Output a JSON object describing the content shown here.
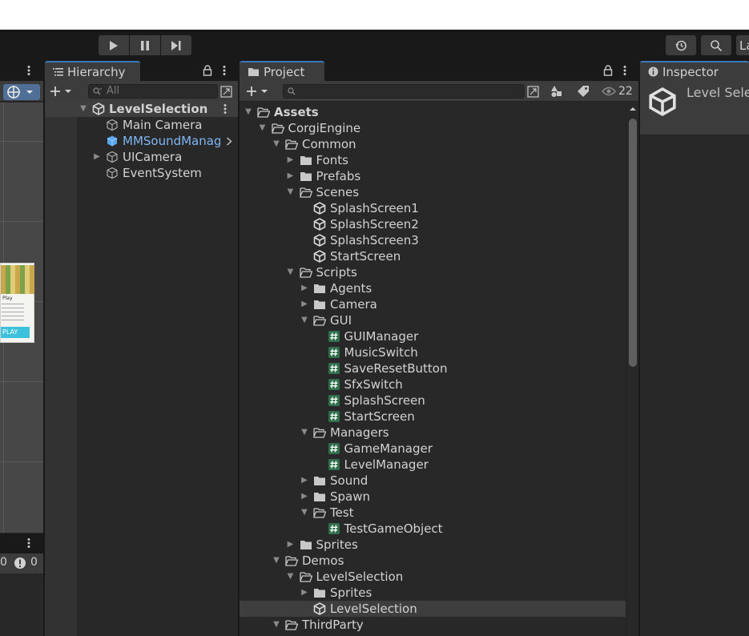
{
  "toolbar": {
    "play_icon": "play-icon",
    "pause_icon": "pause-icon",
    "step_icon": "step-icon",
    "history_icon": "history-icon",
    "search_icon": "search-icon",
    "layers_label": "La"
  },
  "scene": {
    "preview_text_1": "Play",
    "preview_button": "PLAY",
    "console_counts": [
      "0",
      "0"
    ]
  },
  "hierarchy": {
    "tab_label": "Hierarchy",
    "search_placeholder": "All",
    "items": [
      {
        "label": "LevelSelection",
        "icon": "unity-scene-icon"
      },
      {
        "label": "Main Camera",
        "icon": "gameobject-icon"
      },
      {
        "label": "MMSoundManag",
        "icon": "prefab-icon"
      },
      {
        "label": "UICamera",
        "icon": "gameobject-icon"
      },
      {
        "label": "EventSystem",
        "icon": "gameobject-icon"
      }
    ]
  },
  "project": {
    "tab_label": "Project",
    "hidden_count": "22",
    "items": [
      {
        "label": "Assets",
        "type": "folder-open"
      },
      {
        "label": "CorgiEngine",
        "type": "folder-open"
      },
      {
        "label": "Common",
        "type": "folder-open"
      },
      {
        "label": "Fonts",
        "type": "folder"
      },
      {
        "label": "Prefabs",
        "type": "folder"
      },
      {
        "label": "Scenes",
        "type": "folder-open"
      },
      {
        "label": "SplashScreen1",
        "type": "scene"
      },
      {
        "label": "SplashScreen2",
        "type": "scene"
      },
      {
        "label": "SplashScreen3",
        "type": "scene"
      },
      {
        "label": "StartScreen",
        "type": "scene"
      },
      {
        "label": "Scripts",
        "type": "folder-open"
      },
      {
        "label": "Agents",
        "type": "folder"
      },
      {
        "label": "Camera",
        "type": "folder"
      },
      {
        "label": "GUI",
        "type": "folder-open"
      },
      {
        "label": "GUIManager",
        "type": "script"
      },
      {
        "label": "MusicSwitch",
        "type": "script"
      },
      {
        "label": "SaveResetButton",
        "type": "script"
      },
      {
        "label": "SfxSwitch",
        "type": "script"
      },
      {
        "label": "SplashScreen",
        "type": "script"
      },
      {
        "label": "StartScreen",
        "type": "script"
      },
      {
        "label": "Managers",
        "type": "folder-open"
      },
      {
        "label": "GameManager",
        "type": "script"
      },
      {
        "label": "LevelManager",
        "type": "script"
      },
      {
        "label": "Sound",
        "type": "folder"
      },
      {
        "label": "Spawn",
        "type": "folder"
      },
      {
        "label": "Test",
        "type": "folder-open"
      },
      {
        "label": "TestGameObject",
        "type": "script"
      },
      {
        "label": "Sprites",
        "type": "folder"
      },
      {
        "label": "Demos",
        "type": "folder-open"
      },
      {
        "label": "LevelSelection",
        "type": "folder-open"
      },
      {
        "label": "Sprites",
        "type": "folder"
      },
      {
        "label": "LevelSelection",
        "type": "scene"
      },
      {
        "label": "ThirdParty",
        "type": "folder-open"
      }
    ]
  },
  "inspector": {
    "tab_label": "Inspector",
    "object_name": "Level Sele"
  }
}
